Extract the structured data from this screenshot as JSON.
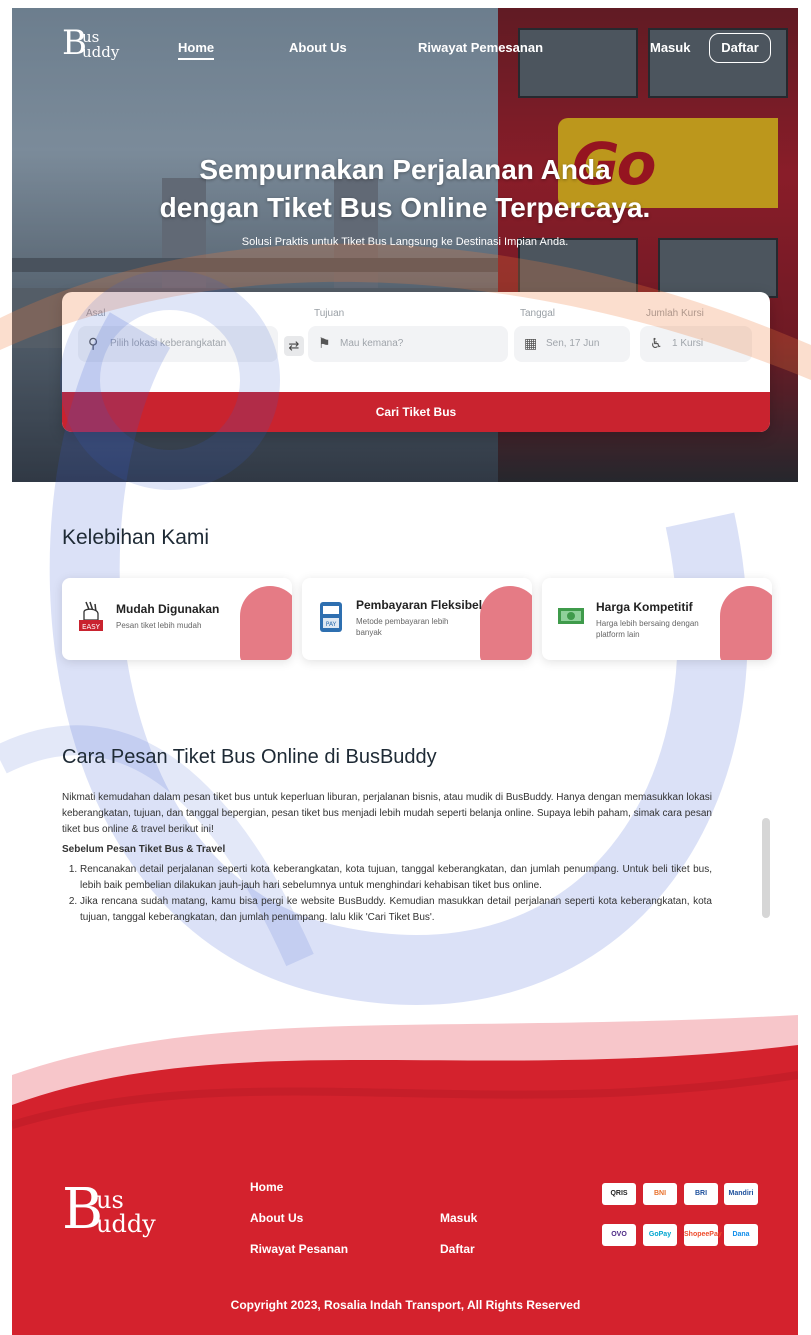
{
  "brand": {
    "logo_big": "B",
    "logo_top": "us",
    "logo_bottom": "uddy"
  },
  "nav": {
    "home": "Home",
    "about": "About Us",
    "history": "Riwayat Pemesanan",
    "login": "Masuk",
    "register": "Daftar"
  },
  "hero": {
    "title_line1": "Sempurnakan Perjalanan Anda",
    "title_line2": "dengan Tiket Bus Online Terpercaya.",
    "subtitle": "Solusi Praktis untuk Tiket Bus Langsung ke Destinasi Impian Anda.",
    "bus_text": "Go"
  },
  "search": {
    "origin_label": "Asal",
    "origin_placeholder": "Pilih lokasi keberangkatan",
    "destination_label": "Tujuan",
    "destination_placeholder": "Mau kemana?",
    "date_label": "Tanggal",
    "date_value": "Sen, 17 Jun",
    "seats_label": "Jumlah Kursi",
    "seats_value": "1 Kursi",
    "button": "Cari Tiket Bus"
  },
  "features": {
    "title": "Kelebihan Kami",
    "items": [
      {
        "title": "Mudah Digunakan",
        "desc": "Pesan tiket lebih mudah",
        "icon": "easy-hand-icon"
      },
      {
        "title": "Pembayaran Fleksibel",
        "desc": "Metode pembayaran lebih banyak",
        "icon": "payment-icon"
      },
      {
        "title": "Harga Kompetitif",
        "desc": "Harga lebih bersaing dengan platform lain",
        "icon": "money-icon"
      }
    ]
  },
  "guide": {
    "title": "Cara Pesan Tiket Bus Online di BusBuddy",
    "intro": "Nikmati kemudahan dalam pesan tiket bus untuk keperluan liburan, perjalanan bisnis, atau mudik di BusBuddy. Hanya dengan memasukkan lokasi keberangkatan, tujuan, dan tanggal bepergian, pesan tiket bus menjadi lebih mudah seperti belanja online. Supaya lebih paham, simak cara pesan tiket bus online & travel berikut ini!",
    "subtitle": "Sebelum Pesan Tiket Bus & Travel",
    "steps": [
      "Rencanakan detail perjalanan seperti kota keberangkatan, kota tujuan, tanggal keberangkatan, dan jumlah penumpang. Untuk beli tiket bus, lebih baik pembelian dilakukan jauh-jauh hari sebelumnya untuk menghindari kehabisan tiket bus online.",
      "Jika rencana sudah matang, kamu bisa pergi ke website BusBuddy. Kemudian masukkan detail perjalanan seperti kota keberangkatan, kota tujuan, tanggal keberangkatan, dan jumlah penumpang. lalu klik 'Cari Tiket Bus'."
    ]
  },
  "footer": {
    "links": [
      "Home",
      "About Us",
      "Riwayat Pesanan"
    ],
    "auth": [
      "Masuk",
      "Daftar"
    ],
    "payments": [
      "QRIS",
      "BNI",
      "BRI",
      "Mandiri",
      "OVO",
      "GoPay",
      "ShopeePay",
      "Dana"
    ],
    "copyright": "Copyright 2023, Rosalia Indah Transport, All Rights Reserved"
  },
  "colors": {
    "primary": "#c9232f",
    "footer": "#d4222d",
    "accent": "#f07a3a",
    "watermark": "#3a5bd0"
  }
}
